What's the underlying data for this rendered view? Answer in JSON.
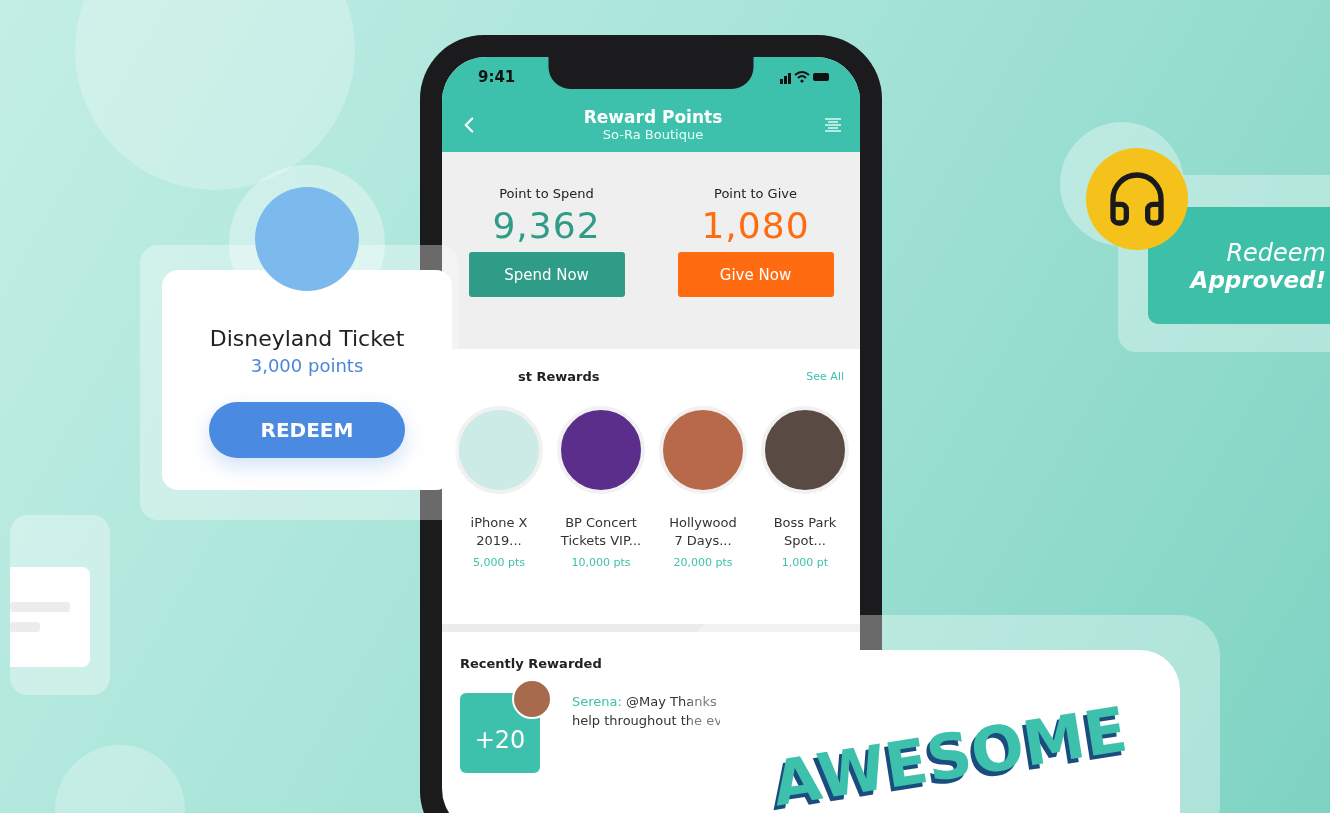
{
  "status_bar": {
    "time": "9:41"
  },
  "header": {
    "title": "Reward Points",
    "subtitle": "So-Ra Boutique"
  },
  "balances": [
    {
      "kind": "spend",
      "label": "Point to Spend",
      "value": "9,362",
      "button": "Spend Now"
    },
    {
      "kind": "give",
      "label": "Point to Give",
      "value": "1,080",
      "button": "Give Now"
    }
  ],
  "rewards_section": {
    "title": "st Rewards",
    "link": "See All",
    "items": [
      {
        "name_lines": [
          "iPhone X",
          "2019..."
        ],
        "points": "5,000 pts"
      },
      {
        "name_lines": [
          "BP Concert",
          "Tickets VIP..."
        ],
        "points": "10,000 pts"
      },
      {
        "name_lines": [
          "Hollywood",
          "7 Days..."
        ],
        "points": "20,000 pts"
      },
      {
        "name_lines": [
          "Boss Park",
          "Spot..."
        ],
        "points": "1,000 pt"
      }
    ]
  },
  "recently_rewarded": {
    "title": "Recently Rewarded",
    "entries": [
      {
        "points": "+20",
        "author": "Serena:",
        "message_lines": [
          "@May Thanks",
          "help throughout the ev"
        ]
      }
    ]
  },
  "redeem_card": {
    "title": "Disneyland Ticket",
    "points": "3,000 points",
    "button": "REDEEM"
  },
  "approved_card": {
    "line_1": "Redeem",
    "line_2": "Approved!"
  },
  "awesome_card": {
    "text": "AWESOME"
  }
}
